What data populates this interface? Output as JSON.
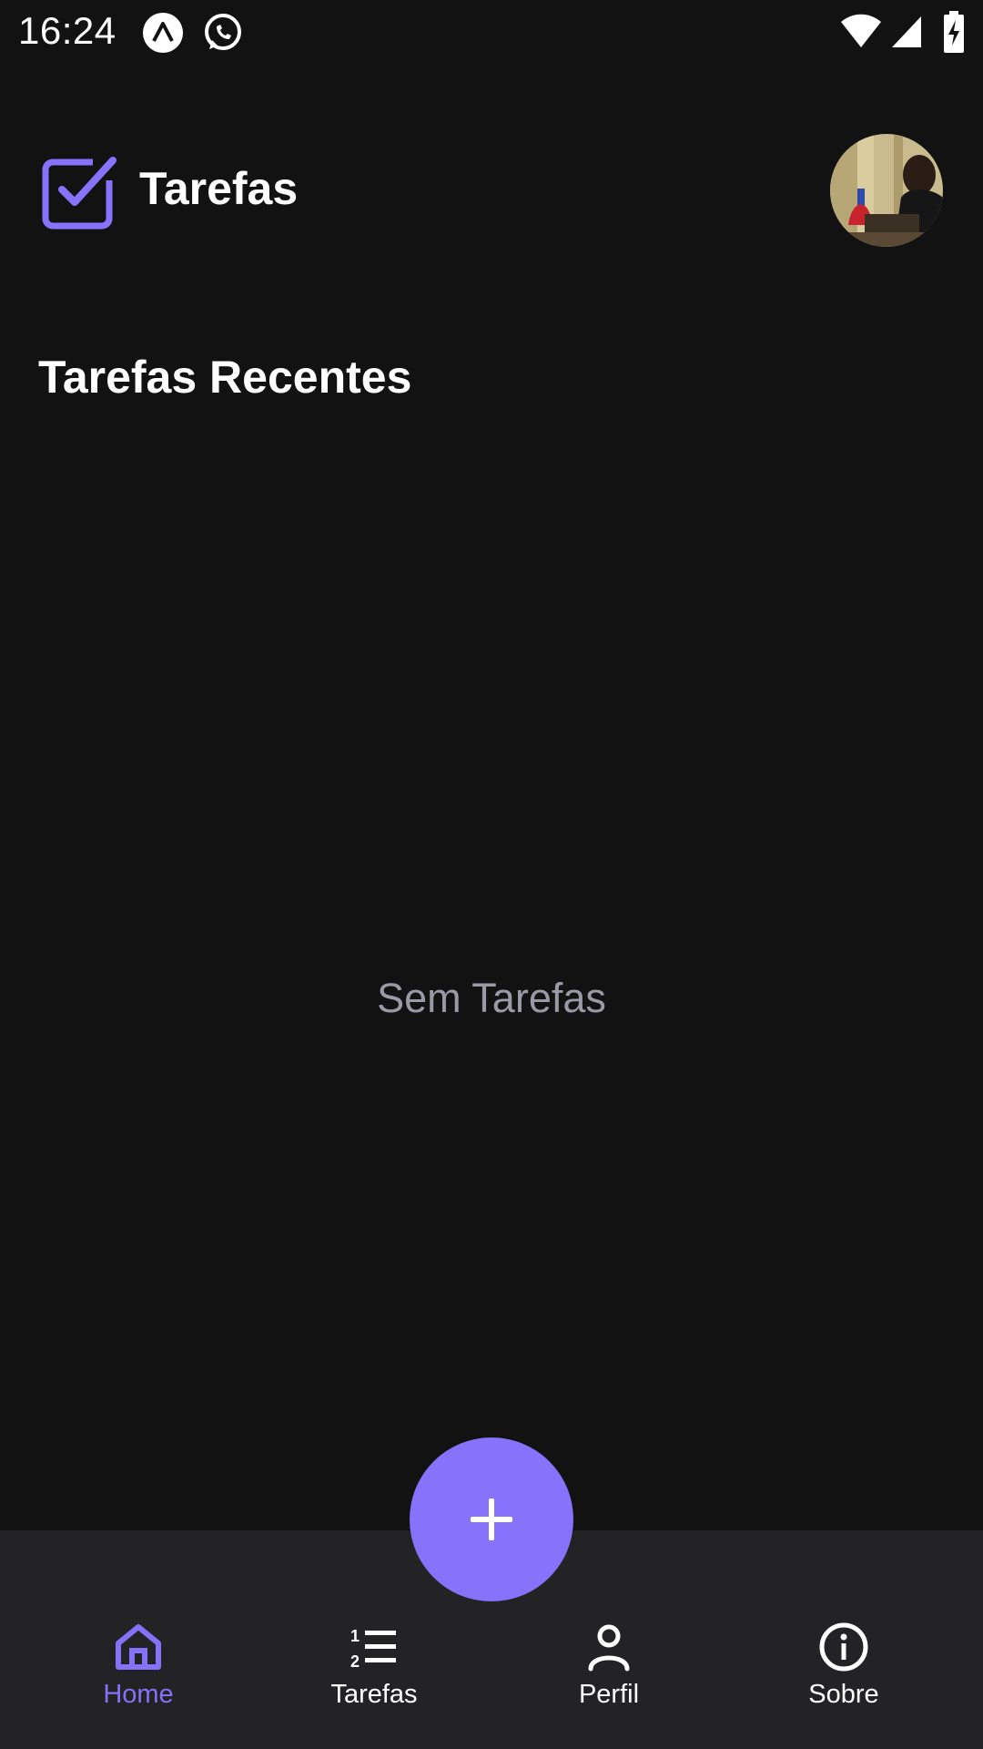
{
  "status_bar": {
    "time": "16:24",
    "icons": [
      "expo-icon",
      "whatsapp-icon",
      "wifi-icon",
      "cellular-signal-icon",
      "battery-charging-icon"
    ]
  },
  "header": {
    "title": "Tarefas",
    "logo_icon": "checkbox-icon",
    "avatar": "profile-photo"
  },
  "section": {
    "title": "Tarefas Recentes",
    "empty_text": "Sem Tarefas"
  },
  "fab": {
    "icon": "plus-icon"
  },
  "bottom_nav": {
    "items": [
      {
        "label": "Home",
        "icon": "home-icon",
        "active": true
      },
      {
        "label": "Tarefas",
        "icon": "list-icon",
        "active": false
      },
      {
        "label": "Perfil",
        "icon": "user-icon",
        "active": false
      },
      {
        "label": "Sobre",
        "icon": "info-icon",
        "active": false
      }
    ]
  },
  "colors": {
    "background": "#121213",
    "accent": "#8672fb",
    "nav_background": "#232325",
    "muted_text": "#9a9aa6"
  }
}
